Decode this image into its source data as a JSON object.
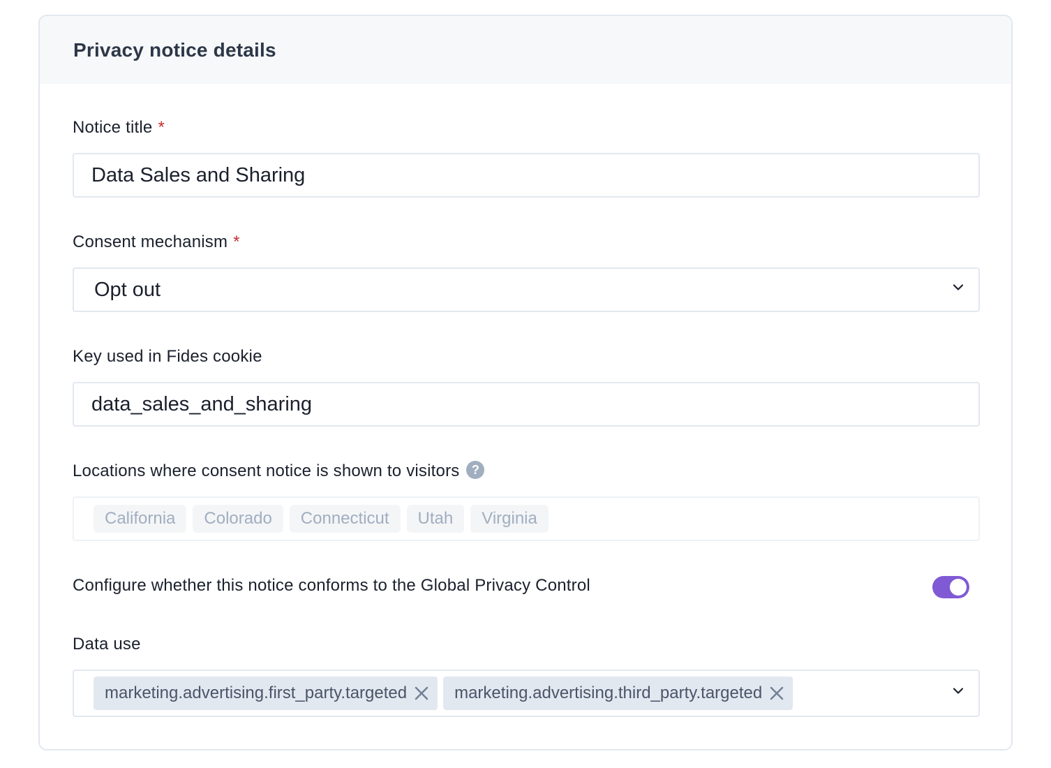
{
  "card": {
    "title": "Privacy notice details"
  },
  "notice_title": {
    "label": "Notice title",
    "required_mark": "*",
    "value": "Data Sales and Sharing"
  },
  "consent_mechanism": {
    "label": "Consent mechanism",
    "required_mark": "*",
    "value": "Opt out",
    "icon": "chevron-down-icon"
  },
  "cookie_key": {
    "label": "Key used in Fides cookie",
    "value": "data_sales_and_sharing"
  },
  "locations": {
    "label": "Locations where consent notice is shown to visitors",
    "help_glyph": "?",
    "help_icon": "question-circle-icon",
    "items": [
      "California",
      "Colorado",
      "Connecticut",
      "Utah",
      "Virginia"
    ]
  },
  "gpc": {
    "label": "Configure whether this notice conforms to the Global Privacy Control",
    "enabled": true,
    "color": "#805ad5"
  },
  "data_use": {
    "label": "Data use",
    "tags": [
      "marketing.advertising.first_party.targeted",
      "marketing.advertising.third_party.targeted"
    ],
    "remove_icon": "close-icon",
    "icon": "chevron-down-icon"
  }
}
